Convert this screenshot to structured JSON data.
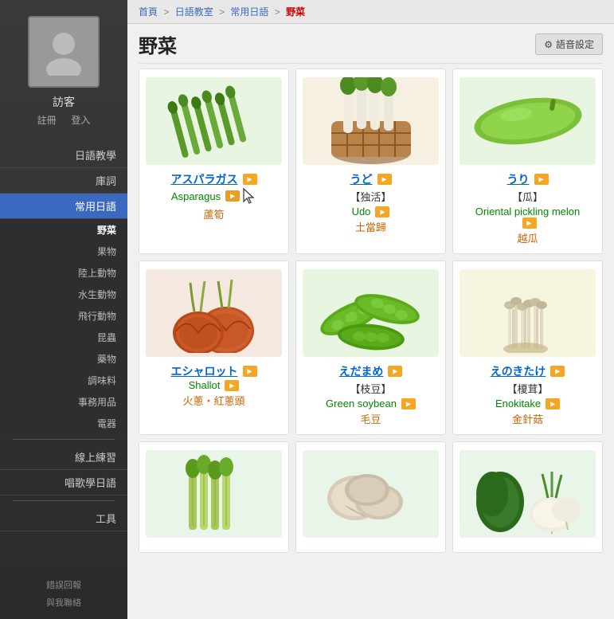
{
  "sidebar": {
    "user": {
      "name": "訪客",
      "links": "註冊　登入"
    },
    "nav": [
      {
        "label": "日語教學",
        "id": "jp-learning"
      },
      {
        "label": "庫詞",
        "id": "dictionary"
      },
      {
        "label": "常用日語",
        "id": "common-jp",
        "active": true
      },
      {
        "label": "野菜",
        "id": "vegetables",
        "sub": true,
        "activeSub": true
      },
      {
        "label": "果物",
        "id": "fruits",
        "sub": true
      },
      {
        "label": "陸上動物",
        "id": "land-animals",
        "sub": true
      },
      {
        "label": "水生動物",
        "id": "water-animals",
        "sub": true
      },
      {
        "label": "飛行動物",
        "id": "flying-animals",
        "sub": true
      },
      {
        "label": "昆蟲",
        "id": "insects",
        "sub": true
      },
      {
        "label": "藥物",
        "id": "medicine",
        "sub": true
      },
      {
        "label": "調味料",
        "id": "seasoning",
        "sub": true
      },
      {
        "label": "事務用品",
        "id": "office",
        "sub": true
      },
      {
        "label": "電器",
        "id": "electronics",
        "sub": true
      },
      {
        "label": "線上練習",
        "id": "online-practice"
      },
      {
        "label": "唱歌學日語",
        "id": "songs"
      }
    ],
    "tools_label": "工具",
    "bottom": [
      {
        "label": "錯誤回報"
      },
      {
        "label": "與我聯絡"
      }
    ]
  },
  "breadcrumb": {
    "items": [
      "首頁",
      "日語教室",
      "常用日語",
      "野菜"
    ],
    "separators": [
      ">",
      ">",
      ">"
    ]
  },
  "page": {
    "title": "野菜",
    "settings_btn": "語音設定"
  },
  "cards": [
    {
      "id": "asparagus",
      "jp_kana": "アスパラガス",
      "kanji": "",
      "en": "Asparagus",
      "zh": "蘆筍",
      "has_cursor": true
    },
    {
      "id": "udo",
      "jp_kana": "うど",
      "kanji": "【独活】",
      "en": "Udo",
      "zh": "土當歸"
    },
    {
      "id": "gourd",
      "jp_kana": "うり",
      "kanji": "【瓜】",
      "en": "Oriental pickling melon",
      "zh": "越瓜"
    },
    {
      "id": "shallot",
      "jp_kana": "エシャロット",
      "kanji": "",
      "en": "Shallot",
      "zh": "火蔥・紅蔥頭"
    },
    {
      "id": "edamame",
      "jp_kana": "えだまめ",
      "kanji": "【枝豆】",
      "en": "Green soybean",
      "zh": "毛豆"
    },
    {
      "id": "enokitake",
      "jp_kana": "えのきたけ",
      "kanji": "【榎茸】",
      "en": "Enokitake",
      "zh": "金針菇"
    },
    {
      "id": "bamboo",
      "jp_kana": "",
      "kanji": "",
      "en": "",
      "zh": ""
    },
    {
      "id": "mushroom",
      "jp_kana": "",
      "kanji": "",
      "en": "",
      "zh": ""
    },
    {
      "id": "turnip",
      "jp_kana": "",
      "kanji": "",
      "en": "",
      "zh": ""
    }
  ]
}
